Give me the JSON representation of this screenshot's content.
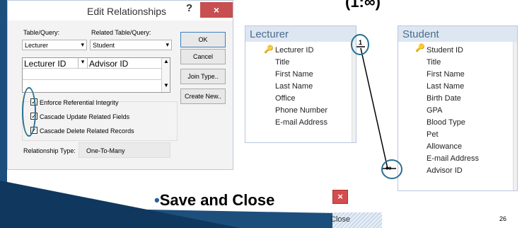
{
  "dialog": {
    "title": "Edit Relationships",
    "help": "?",
    "close_glyph": "×",
    "table_query_label": "Table/Query:",
    "related_label": "Related Table/Query:",
    "table_value": "Lecturer",
    "related_value": "Student",
    "grid": {
      "left": "Lecturer ID",
      "right": "Advisor ID"
    },
    "buttons": {
      "ok": "OK",
      "cancel": "Cancel",
      "join": "Join Type..",
      "create": "Create New.."
    },
    "checks": [
      {
        "label": "Enforce Referential Integrity"
      },
      {
        "label": "Cascade Update Related Fields"
      },
      {
        "label": "Cascade Delete Related Records"
      }
    ],
    "relationship_type_label": "Relationship Type:",
    "relationship_type_value": "One-To-Many"
  },
  "lecturer": {
    "title": "Lecturer",
    "key_field": "Lecturer ID",
    "fields": [
      "Title",
      "First Name",
      "Last Name",
      "Office",
      "Phone Number",
      "E-mail Address"
    ]
  },
  "student": {
    "title": "Student",
    "key_field": "Student ID",
    "fields": [
      "Title",
      "First Name",
      "Last Name",
      "Birth Date",
      "GPA",
      "Blood Type",
      "Pet",
      "Allowance",
      "E-mail Address",
      "Advisor ID"
    ]
  },
  "relationship": {
    "one_symbol": "1",
    "many_symbol": "∞",
    "caption": "(1:∞)"
  },
  "slide": {
    "bullet": "•",
    "save_close": "Save and Close",
    "close_label": "Close",
    "page_number": "26",
    "close_glyph": "×"
  }
}
